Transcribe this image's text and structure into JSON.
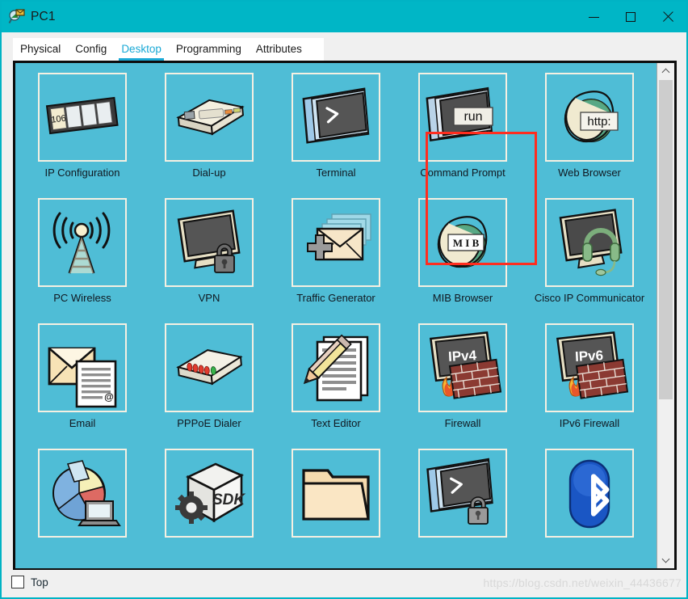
{
  "window": {
    "title": "PC1",
    "icon": "packet-tracer-device-icon",
    "accent_color": "#00b6c6",
    "desktop_bg": "#4fbdd6",
    "controls": {
      "minimize": "—",
      "maximize": "□",
      "close": "✕"
    }
  },
  "tabs": [
    {
      "label": "Physical",
      "active": false
    },
    {
      "label": "Config",
      "active": false
    },
    {
      "label": "Desktop",
      "active": true
    },
    {
      "label": "Programming",
      "active": false
    },
    {
      "label": "Attributes",
      "active": false
    }
  ],
  "desktop": {
    "highlight_color": "#ff2d1f",
    "highlighted_item": "Command Prompt",
    "items": [
      {
        "label": "IP Configuration",
        "icon": "ip-configuration-icon",
        "badge": "106",
        "highlighted": false
      },
      {
        "label": "Dial-up",
        "icon": "dial-up-modem-icon",
        "badge": "",
        "highlighted": false
      },
      {
        "label": "Terminal",
        "icon": "terminal-icon",
        "badge": ">",
        "highlighted": false
      },
      {
        "label": "Command Prompt",
        "icon": "command-prompt-icon",
        "badge": "run",
        "highlighted": true
      },
      {
        "label": "Web Browser",
        "icon": "web-browser-icon",
        "badge": "http:",
        "highlighted": false
      },
      {
        "label": "PC Wireless",
        "icon": "pc-wireless-icon",
        "badge": "",
        "highlighted": false
      },
      {
        "label": "VPN",
        "icon": "vpn-icon",
        "badge": "",
        "highlighted": false
      },
      {
        "label": "Traffic Generator",
        "icon": "traffic-generator-icon",
        "badge": "",
        "highlighted": false
      },
      {
        "label": "MIB Browser",
        "icon": "mib-browser-icon",
        "badge": "M I B",
        "highlighted": false
      },
      {
        "label": "Cisco IP Communicator",
        "icon": "ip-communicator-icon",
        "badge": "",
        "highlighted": false
      },
      {
        "label": "Email",
        "icon": "email-icon",
        "badge": "@",
        "highlighted": false
      },
      {
        "label": "PPPoE Dialer",
        "icon": "pppoe-dialer-icon",
        "badge": "",
        "highlighted": false
      },
      {
        "label": "Text Editor",
        "icon": "text-editor-icon",
        "badge": "",
        "highlighted": false
      },
      {
        "label": "Firewall",
        "icon": "firewall-icon",
        "badge": "IPv4",
        "highlighted": false
      },
      {
        "label": "IPv6 Firewall",
        "icon": "ipv6-firewall-icon",
        "badge": "IPv6",
        "highlighted": false
      },
      {
        "label": "",
        "icon": "traffic-monitor-icon",
        "badge": "",
        "highlighted": false
      },
      {
        "label": "",
        "icon": "sdk-icon",
        "badge": "SDK",
        "highlighted": false
      },
      {
        "label": "",
        "icon": "file-folder-icon",
        "badge": "",
        "highlighted": false
      },
      {
        "label": "",
        "icon": "secure-terminal-icon",
        "badge": ">",
        "highlighted": false
      },
      {
        "label": "",
        "icon": "bluetooth-icon",
        "badge": "",
        "highlighted": false
      }
    ]
  },
  "scrollbar": {
    "up_arrow": "scroll-up-icon",
    "down_arrow": "scroll-down-icon",
    "thumb_position": "top"
  },
  "bottom": {
    "checkbox_label": "Top",
    "checkbox_checked": false,
    "watermark": "https://blog.csdn.net/weixin_44436677"
  }
}
